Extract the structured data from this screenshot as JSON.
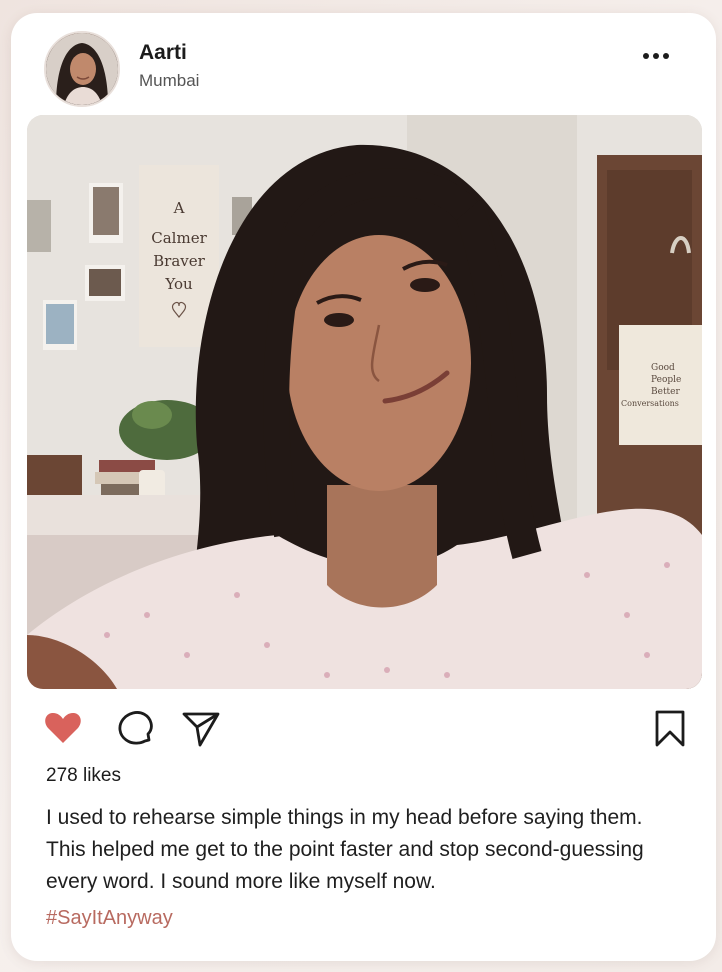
{
  "post": {
    "user": {
      "name": "Aarti",
      "location": "Mumbai"
    },
    "poster_text": [
      "A",
      "Calmer",
      "Braver",
      "You"
    ],
    "tote_bag_text": [
      "Good",
      "People",
      "Better",
      "Conversations"
    ],
    "liked": true,
    "likes_text": "278 likes",
    "caption": "I used to rehearse simple things in my head before saying them. This helped me get to the point faster and stop second-guessing every word. I sound more like myself now.",
    "hashtag": "#SayItAnyway"
  },
  "icons": {
    "more": "more-horizontal-icon",
    "like": "heart-icon",
    "comment": "comment-icon",
    "share": "send-icon",
    "save": "bookmark-icon"
  },
  "colors": {
    "heart": "#d9625c",
    "hashtag": "#b86a60",
    "text": "#1c1c1c"
  }
}
